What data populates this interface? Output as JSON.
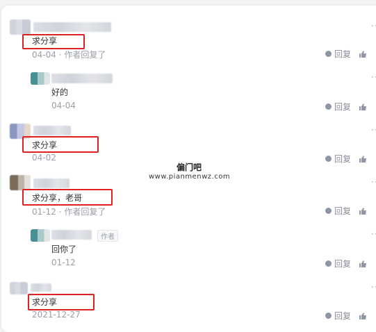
{
  "comments": [
    {
      "text": "求分享",
      "meta": "04-04 · 作者回复了",
      "reply": "回复"
    },
    {
      "text": "好的",
      "meta": "04-04",
      "reply": "回复"
    },
    {
      "text": "求分享",
      "meta": "04-02",
      "reply": "回复"
    },
    {
      "text": "求分享，老哥",
      "meta": "01-12 · 作者回复了",
      "reply": "回复"
    },
    {
      "text": "回你了",
      "meta": "01-12",
      "reply": "回复",
      "tag": "作者"
    },
    {
      "text": "求分享",
      "meta": "2021-12-27",
      "reply": "回复"
    }
  ],
  "watermark": {
    "title": "偏门吧",
    "url": "www.pianmenwz.com"
  },
  "more_glyph": "··"
}
